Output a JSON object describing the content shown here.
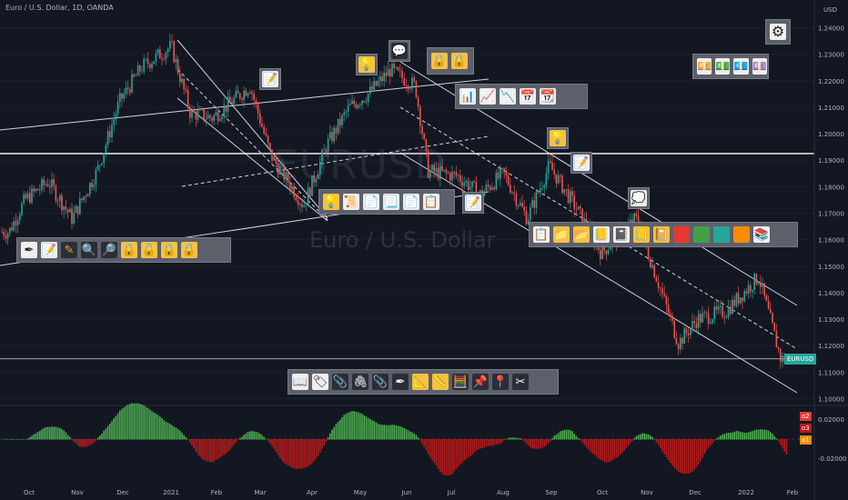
{
  "symbol_title": "Euro / U.S. Dollar, 1D, OANDA",
  "watermark": {
    "symbol": "EURUSD",
    "name": "Euro / U.S. Dollar"
  },
  "currency_label": "USD",
  "price_tag": "EURUSD",
  "oscillator_tags": [
    "o2",
    "o3",
    "o1"
  ],
  "colors": {
    "background": "#131722",
    "up": "#26a69a",
    "down": "#ef5350",
    "osc_up": "#4caf50",
    "osc_down": "#b71c1c",
    "line": "#d1d4dc"
  },
  "chart_data": {
    "type": "candlestick",
    "title": "Euro / U.S. Dollar, 1D, OANDA",
    "xlabel": "",
    "ylabel": "USD",
    "x_ticks": [
      "Oct",
      "Nov",
      "Dec",
      "2021",
      "Feb",
      "Mar",
      "Apr",
      "May",
      "Jun",
      "Jul",
      "Aug",
      "Sep",
      "Oct",
      "Nov",
      "Dec",
      "2022",
      "Feb"
    ],
    "y_ticks": [
      "1.24000",
      "1.23000",
      "1.22000",
      "1.21000",
      "1.20000",
      "1.19000",
      "1.18000",
      "1.17000",
      "1.16000",
      "1.15000",
      "1.14000",
      "1.13000",
      "1.12000",
      "1.11000",
      "1.10000"
    ],
    "ylim": [
      1.095,
      1.245
    ],
    "close_series": [
      {
        "date": "2020-09-25",
        "close": 1.163
      },
      {
        "date": "2020-10-05",
        "close": 1.175
      },
      {
        "date": "2020-10-20",
        "close": 1.182
      },
      {
        "date": "2020-11-04",
        "close": 1.168
      },
      {
        "date": "2020-11-20",
        "close": 1.186
      },
      {
        "date": "2020-12-04",
        "close": 1.212
      },
      {
        "date": "2020-12-18",
        "close": 1.225
      },
      {
        "date": "2021-01-06",
        "close": 1.233
      },
      {
        "date": "2021-01-18",
        "close": 1.208
      },
      {
        "date": "2021-02-01",
        "close": 1.206
      },
      {
        "date": "2021-02-25",
        "close": 1.218
      },
      {
        "date": "2021-03-10",
        "close": 1.192
      },
      {
        "date": "2021-03-31",
        "close": 1.173
      },
      {
        "date": "2021-04-15",
        "close": 1.196
      },
      {
        "date": "2021-04-29",
        "close": 1.21
      },
      {
        "date": "2021-05-11",
        "close": 1.215
      },
      {
        "date": "2021-05-25",
        "close": 1.224
      },
      {
        "date": "2021-06-10",
        "close": 1.218
      },
      {
        "date": "2021-06-18",
        "close": 1.186
      },
      {
        "date": "2021-07-07",
        "close": 1.184
      },
      {
        "date": "2021-07-21",
        "close": 1.177
      },
      {
        "date": "2021-08-05",
        "close": 1.185
      },
      {
        "date": "2021-08-20",
        "close": 1.168
      },
      {
        "date": "2021-09-03",
        "close": 1.188
      },
      {
        "date": "2021-09-20",
        "close": 1.172
      },
      {
        "date": "2021-10-06",
        "close": 1.155
      },
      {
        "date": "2021-10-28",
        "close": 1.168
      },
      {
        "date": "2021-11-10",
        "close": 1.146
      },
      {
        "date": "2021-11-24",
        "close": 1.121
      },
      {
        "date": "2021-12-06",
        "close": 1.13
      },
      {
        "date": "2021-12-24",
        "close": 1.133
      },
      {
        "date": "2022-01-14",
        "close": 1.146
      },
      {
        "date": "2022-01-28",
        "close": 1.115
      }
    ],
    "last_price_label": "EURUSD",
    "horizontal_lines": [
      1.1925,
      1.115
    ],
    "oscillator": {
      "y_ticks": [
        "0.02000",
        "-0.02000"
      ],
      "ylim": [
        -0.035,
        0.03
      ]
    }
  },
  "toolbars": {
    "t1": {
      "icons": [
        "sound-pen-icon",
        "note-icon",
        "pencil-icon",
        "magnifier-left-icon",
        "magnifier-right-icon",
        "lock-icon",
        "unlock-icon",
        "lock-icon",
        "lock-icon"
      ]
    },
    "t2": {
      "icons": [
        "lightbulb-icon",
        "scroll-icon",
        "page-icon",
        "page-icon",
        "page-icon",
        "script-icon"
      ]
    },
    "t3": {
      "icons": [
        "clipboard-icon",
        "folder-icon",
        "open-folder-icon",
        "ledger-icon",
        "notebook-icon",
        "ledger-icon",
        "red-book-icon",
        "green-book-icon",
        "blue-book-icon",
        "orange-book-icon",
        "books-icon"
      ]
    },
    "t4": {
      "icons": [
        "bar-chart-icon",
        "chart-up-icon",
        "chart-down-icon",
        "calendar-icon",
        "date-icon"
      ]
    },
    "t5": {
      "icons": [
        "lock-icon",
        "lock-icon"
      ]
    },
    "t6": {
      "icons": [
        "book-icon",
        "label-icon",
        "paperclip-icon",
        "linked-clips-icon",
        "paperclip-icon",
        "pen-icon",
        "triangle-ruler-icon",
        "ruler-icon",
        "abacus-icon",
        "pushpin-icon",
        "round-pin-icon",
        "scissors-icon"
      ]
    },
    "t7": {
      "icons": [
        "money-icon",
        "money-icon",
        "money-icon",
        "money-icon"
      ]
    }
  }
}
